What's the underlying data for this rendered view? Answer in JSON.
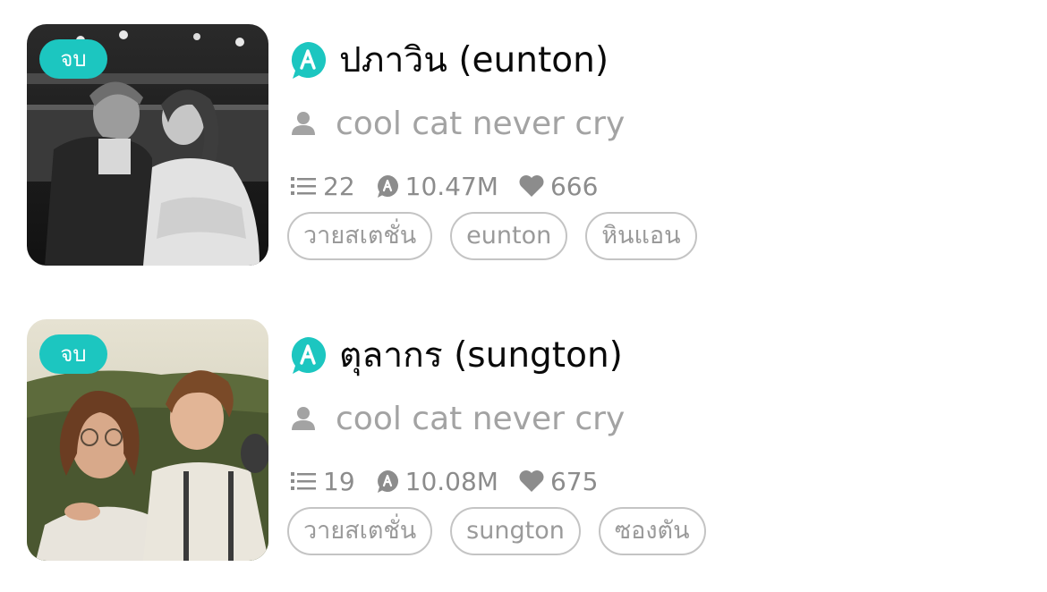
{
  "stories": [
    {
      "status_badge": "จบ",
      "title": "ปภาวิน (eunton)",
      "author": "cool cat never cry",
      "chapters": "22",
      "views": "10.47M",
      "likes": "666",
      "tags": [
        "วายสเตชั่น",
        "eunton",
        "หินแอน"
      ],
      "cover_style": "grayscale"
    },
    {
      "status_badge": "จบ",
      "title": "ตุลากร (sungton)",
      "author": "cool cat never cry",
      "chapters": "19",
      "views": "10.08M",
      "likes": "675",
      "tags": [
        "วายสเตชั่น",
        "sungton",
        "ซองตัน"
      ],
      "cover_style": "color"
    }
  ],
  "icons": {
    "app": "app-logo-icon",
    "author": "person-icon",
    "chapters": "list-icon",
    "views": "view-count-icon",
    "likes": "heart-icon"
  },
  "colors": {
    "accent": "#1cc6c0",
    "muted_text": "#a3a3a3",
    "tag_border": "#c4c4c4"
  }
}
